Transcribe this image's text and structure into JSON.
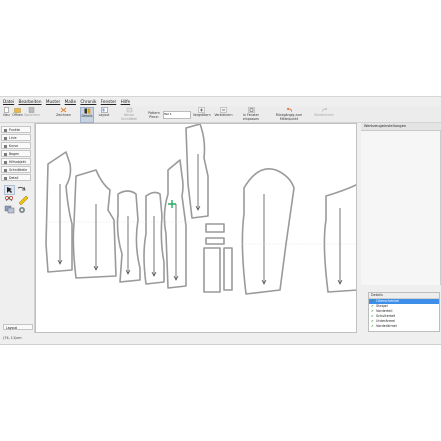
{
  "menu": {
    "items": [
      "Datei",
      "Bearbeiten",
      "Muster",
      "Maße",
      "Chronik",
      "Fenster",
      "Hilfe"
    ]
  },
  "toolbar": {
    "buttons": [
      {
        "label": "Neu"
      },
      {
        "label": "Öffnen"
      },
      {
        "label": "Speichern"
      },
      {
        "label": "Zeichnen"
      },
      {
        "label": "Details"
      },
      {
        "label": "Layout"
      },
      {
        "label": "Neues Schnittteil"
      },
      {
        "label": "Vergrößern"
      },
      {
        "label": "Verkleinern"
      },
      {
        "label": "In Fenster einpassen"
      },
      {
        "label": "Rückgängig zum Mittelpunkt"
      },
      {
        "label": "Wiederholen"
      }
    ],
    "pattern_piece_label": "Pattern Piece:",
    "pattern_piece_value": "Teil 1"
  },
  "tools": [
    "Punkte",
    "Linie",
    "Kurve",
    "Bogen",
    "Hilfsobjekt",
    "Schnittteile",
    "Detail"
  ],
  "layout_tab": "Layout",
  "right_panel": {
    "title": "Werkzeugeinstellungen"
  },
  "details_panel": {
    "title": "Details",
    "items": [
      {
        "label": "Oberschenkel",
        "selected": true
      },
      {
        "label": "Steigel",
        "selected": false
      },
      {
        "label": "Vorderteil",
        "selected": false
      },
      {
        "label": "Schulterteil",
        "selected": false
      },
      {
        "label": "Unterärmel",
        "selected": false
      },
      {
        "label": "Vorderärmel",
        "selected": false
      }
    ]
  },
  "status": "(74, 11)cm",
  "colors": {
    "accent": "#3d8ee8",
    "selection": "#c8d3e2",
    "canvas_bg": "#ffffff",
    "dialog_bg": "#efefef"
  }
}
